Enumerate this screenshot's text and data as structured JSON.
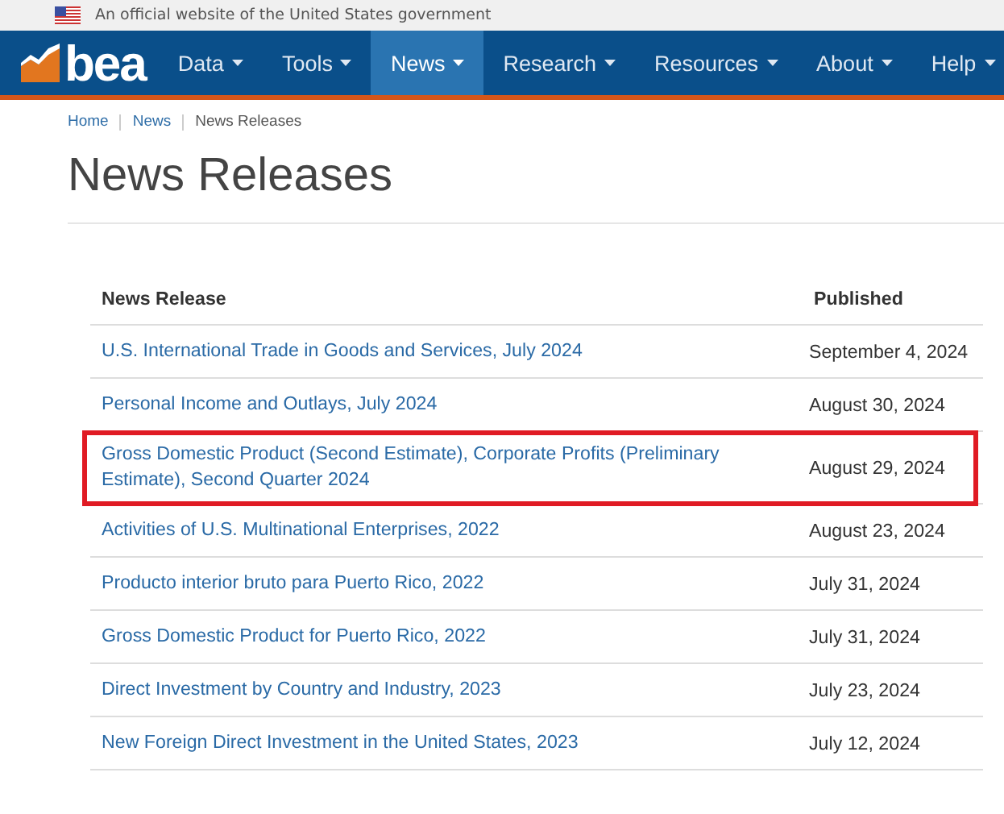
{
  "gov_banner": {
    "text": "An official website of the United States government"
  },
  "nav": {
    "logo": "bea",
    "items": [
      {
        "label": "Data",
        "selected": false
      },
      {
        "label": "Tools",
        "selected": false
      },
      {
        "label": "News",
        "selected": true
      },
      {
        "label": "Research",
        "selected": false
      },
      {
        "label": "Resources",
        "selected": false
      },
      {
        "label": "About",
        "selected": false
      },
      {
        "label": "Help",
        "selected": false
      }
    ]
  },
  "breadcrumb": [
    {
      "label": "Home",
      "kind": "link"
    },
    {
      "label": "News",
      "kind": "link"
    },
    {
      "label": "News Releases",
      "kind": "current"
    }
  ],
  "title": "News Releases",
  "table": {
    "columns": [
      "News Release",
      "Published"
    ],
    "rows": [
      {
        "title": "U.S. International Trade in Goods and Services, July 2024",
        "published": "September 4, 2024",
        "highlighted": false
      },
      {
        "title": "Personal Income and Outlays, July 2024",
        "published": "August 30, 2024",
        "highlighted": false
      },
      {
        "title": "Gross Domestic Product (Second Estimate), Corporate Profits (Preliminary Estimate), Second Quarter 2024",
        "published": "August 29, 2024",
        "highlighted": true
      },
      {
        "title": "Activities of U.S. Multinational Enterprises, 2022",
        "published": "August 23, 2024",
        "highlighted": false
      },
      {
        "title": "Producto interior bruto para Puerto Rico, 2022",
        "published": "July 31, 2024",
        "highlighted": false
      },
      {
        "title": "Gross Domestic Product for Puerto Rico, 2022",
        "published": "July 31, 2024",
        "highlighted": false
      },
      {
        "title": "Direct Investment by Country and Industry, 2023",
        "published": "July 23, 2024",
        "highlighted": false
      },
      {
        "title": "New Foreign Direct Investment in the United States, 2023",
        "published": "July 12, 2024",
        "highlighted": false
      }
    ]
  }
}
